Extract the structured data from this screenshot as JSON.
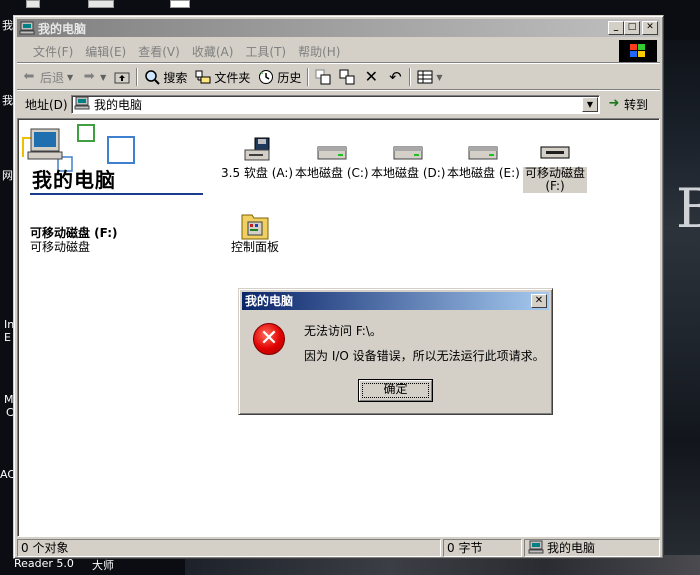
{
  "desktop": {
    "texts": [
      "我",
      "我",
      "网",
      "In",
      "E",
      "M",
      "C",
      "AC",
      "Reader 5.0",
      "大师"
    ]
  },
  "window": {
    "title": "我的电脑",
    "menu": [
      "文件(F)",
      "编辑(E)",
      "查看(V)",
      "收藏(A)",
      "工具(T)",
      "帮助(H)"
    ],
    "toolbar": {
      "back": "后退",
      "search": "搜索",
      "folders": "文件夹",
      "history": "历史"
    },
    "address": {
      "label": "地址(D)",
      "value": "我的电脑",
      "go": "转到"
    },
    "sidebar": {
      "title": "我的电脑",
      "selected_name": "可移动磁盘 (F:)",
      "selected_type": "可移动磁盘"
    },
    "items": [
      {
        "label": "3.5 软盘 (A:)",
        "icon": "floppy-drive-icon"
      },
      {
        "label": "本地磁盘 (C:)",
        "icon": "hard-disk-icon"
      },
      {
        "label": "本地磁盘 (D:)",
        "icon": "hard-disk-icon"
      },
      {
        "label": "本地磁盘 (E:)",
        "icon": "hard-disk-icon"
      },
      {
        "label": "可移动磁盘",
        "label2": "(F:)",
        "icon": "removable-disk-icon"
      },
      {
        "label": "控制面板",
        "icon": "control-panel-icon"
      }
    ],
    "status": {
      "objects": "0 个对象",
      "size": "0 字节",
      "location": "我的电脑"
    }
  },
  "dialog": {
    "title": "我的电脑",
    "message1": "无法访问 F:\\。",
    "message2": "因为 I/O 设备错误，所以无法运行此项请求。",
    "ok": "确定"
  },
  "colors": {
    "dialog_title_start": "#0a246a",
    "dialog_title_end": "#a6caf0",
    "window_inactive_title": "#808080",
    "error_red": "#e00000"
  }
}
